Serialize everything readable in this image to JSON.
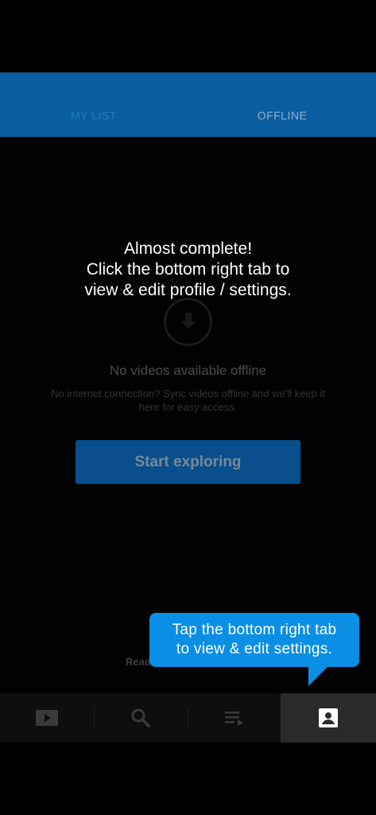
{
  "tabs": {
    "my_list": "MY LIST",
    "offline": "OFFLINE"
  },
  "empty_state": {
    "icon": "download-icon",
    "title": "No videos available offline",
    "description": "No internet connection? Sync videos offline and we'll keep it here for easy access.",
    "button_label": "Start exploring"
  },
  "coach": {
    "headline": "Almost complete!",
    "line1": "Click the bottom right tab to",
    "line2": "view & edit profile / settings."
  },
  "tooltip": {
    "line1": "Tap the bottom right tab",
    "line2": "to view & edit settings."
  },
  "footer_text": "Read",
  "bottom_nav": {
    "items": [
      {
        "icon": "video-play-icon"
      },
      {
        "icon": "search-icon"
      },
      {
        "icon": "playlist-icon"
      },
      {
        "icon": "profile-icon",
        "active": true
      }
    ]
  },
  "colors": {
    "tabbar": "#0a5da0",
    "tooltip": "#0b8fe5",
    "button": "#084f8b"
  }
}
